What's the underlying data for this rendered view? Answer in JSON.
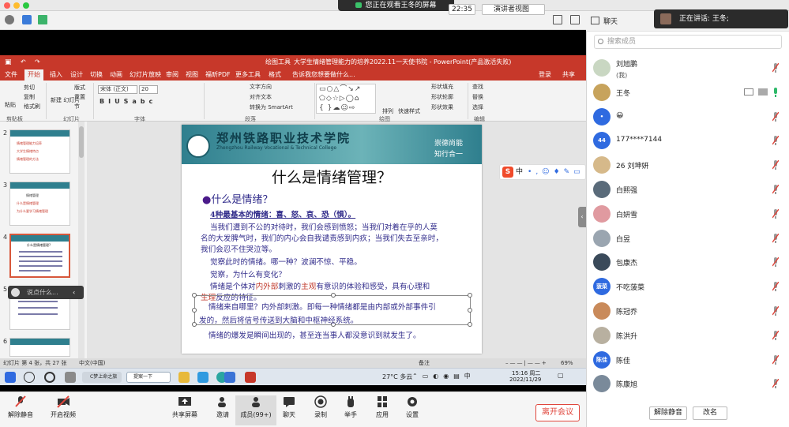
{
  "top_bar": {
    "viewing_label": "您正在观看王冬的屏幕"
  },
  "zoom_toolbar": {
    "time": "22:35",
    "view_label": "演讲者视图"
  },
  "powerpoint": {
    "window_title": "大学生情绪管理能力的培养2022.11一天使书院 - PowerPoint(产品激活失败)",
    "drawing_tools": "绘图工具",
    "login": "登录",
    "share": "共享",
    "tabs": [
      "文件",
      "开始",
      "插入",
      "设计",
      "切换",
      "动画",
      "幻灯片放映",
      "审阅",
      "视图",
      "福昕PDF",
      "更多工具",
      "格式"
    ],
    "tell_me": "告诉我您想要做什么...",
    "ribbon": {
      "paste": "粘贴",
      "cut": "剪切",
      "copy": "复制",
      "format_painter": "格式刷",
      "new_slide": "新建\n幻灯片",
      "layout": "版式",
      "reset": "重置",
      "section": "节",
      "font_name": "宋体 (正文)",
      "font_size": "20",
      "text_direction": "文字方向",
      "align_text": "对齐文本",
      "smartart": "转换为 SmartArt",
      "arrange": "排列",
      "quick_styles": "快速样式",
      "shape_fill": "形状填充",
      "shape_outline": "形状轮廓",
      "shape_effects": "形状效果",
      "find": "查找",
      "replace": "替换",
      "select": "选择",
      "groups": [
        "剪贴板",
        "幻灯片",
        "字体",
        "段落",
        "绘图",
        "编辑"
      ]
    },
    "thumbnails": [
      {
        "num": "2",
        "lines": [
          "情绪管理能力培养",
          "大学生情绪特点",
          "情绪管理的方法"
        ]
      },
      {
        "num": "3",
        "lines": [
          "情绪管理",
          "什么是情绪管理",
          "为什么要学习情绪管理"
        ]
      },
      {
        "num": "4",
        "lines": [
          "什么是情绪管理?"
        ]
      },
      {
        "num": "5",
        "lines": []
      },
      {
        "num": "6",
        "lines": []
      }
    ],
    "chat_placeholder": "说点什么...",
    "slide": {
      "school_cn": "郑州铁路职业技术学院",
      "school_en": "Zhengzhou Railway Vocational & Technical College",
      "motto_1": "崇德尚能",
      "motto_2": "知行合一",
      "title": "什么是情绪管理？",
      "q1_bullet": "●",
      "q1": "什么是情绪？",
      "l1": "4种最基本的情绪：喜、怒、哀、恐（惧）。",
      "l2": "当我们遭到不公的对待时，我们会感到愤怒；当我们对着在乎的人莫",
      "l3": "名的大发脾气时，我们的内心会自我谴责感到内疚；当我们失去至亲时，",
      "l4": "我们会忍不住哭泣等。",
      "l5": "觉察此时的情绪。哪一种？波澜不惊、平稳。",
      "l6": "觉察，为什么有变化？",
      "l7a": "情绪是个体对",
      "l7b": "内外部",
      "l7c": "刺激的",
      "l7d": "主观",
      "l7e": "有意识的体验和感受，具有心理和",
      "l8a": "生理",
      "l8b": "反应的特征。",
      "l9": "情绪来自哪里？内外部刺激。即每一种情绪都是由内部或外部事件引",
      "l10": "发的，然后将信号传送到大脑和中枢神经系统。",
      "l11": "情绪的爆发是瞬间出现的，甚至连当事人都没意识到就发生了。"
    },
    "sogou": "中",
    "status": {
      "slide_info": "幻灯片 第 4 张，共 27 张",
      "lang": "中文(中国)",
      "notes": "备注",
      "zoom": "69%"
    }
  },
  "taskbar": {
    "app_label": "C梦上命之旅",
    "app2": "提案一下",
    "weather": "27°C 多云",
    "clock_time": "15:16 周二",
    "clock_date": "2022/11/29"
  },
  "zoom_bottom": {
    "mute": "解除静音",
    "video": "开启视频",
    "share": "共享屏幕",
    "invite": "邀请",
    "members": "成员(99+)",
    "chat": "聊天",
    "record": "录制",
    "raise": "举手",
    "apps": "应用",
    "settings": "设置",
    "leave": "离开会议"
  },
  "panel": {
    "title": "聊天",
    "speaking": "正在讲话: 王冬;",
    "search_placeholder": "搜索成员",
    "members": [
      {
        "name": "刘旭鹏",
        "sub": "(我)",
        "avatar": "",
        "color": "#c9d7c2"
      },
      {
        "name": "王冬",
        "sub": "",
        "avatar": "",
        "color": "#c7a35c"
      },
      {
        "name": "😀",
        "sub": "",
        "avatar": "•",
        "color": "#2f6ae0"
      },
      {
        "name": "177****7144",
        "sub": "",
        "avatar": "44",
        "color": "#2f6ae0"
      },
      {
        "name": "26 刘坤妍",
        "sub": "",
        "avatar": "",
        "color": "#d6b98a"
      },
      {
        "name": "白熙强",
        "sub": "",
        "avatar": "",
        "color": "#5a6b7a"
      },
      {
        "name": "白妍雪",
        "sub": "",
        "avatar": "",
        "color": "#e09aa0"
      },
      {
        "name": "白昱",
        "sub": "",
        "avatar": "",
        "color": "#9aa5b0"
      },
      {
        "name": "包康杰",
        "sub": "",
        "avatar": "",
        "color": "#3a4a5a"
      },
      {
        "name": "不吃菠菜",
        "sub": "",
        "avatar": "菠菜",
        "color": "#2f6ae0"
      },
      {
        "name": "陈冠乔",
        "sub": "",
        "avatar": "",
        "color": "#c98a5a"
      },
      {
        "name": "陈洪升",
        "sub": "",
        "avatar": "",
        "color": "#b8b0a0"
      },
      {
        "name": "陈佳",
        "sub": "",
        "avatar": "陈佳",
        "color": "#2f6ae0"
      },
      {
        "name": "陈康旭",
        "sub": "",
        "avatar": "",
        "color": "#7a8a9a"
      }
    ],
    "mute_all": "解除静音",
    "rename": "改名"
  }
}
